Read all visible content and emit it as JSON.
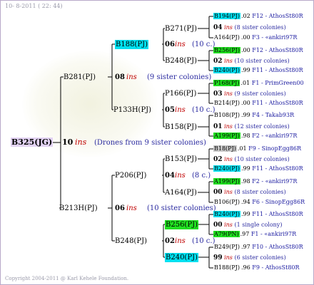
{
  "header": "10-  8-2011 ( 22: 44)",
  "footer": "Copyright 2004-2011 @ Karl Kehele Foundation.",
  "gen0": {
    "label": "B325(JG)",
    "year": "10",
    "ins": "ins",
    "note": "(Drones from 9 sister colonies)"
  },
  "gen1": {
    "sire": {
      "label": "B281(PJ)",
      "year": "08",
      "ins": "ins",
      "note": "(9 sister colonies)"
    },
    "dam": {
      "label": "B213H(PJ)",
      "year": "06",
      "ins": "ins",
      "note": "(10 sister colonies)"
    }
  },
  "gen2": [
    {
      "label": "B188(PJ)",
      "year": "06",
      "ins": "ins",
      "note": "(10 c.)"
    },
    {
      "label": "P133H(PJ)",
      "year": "05",
      "ins": "ins",
      "note": "(10 c.)"
    },
    {
      "label": "P206(PJ)",
      "year": "04",
      "ins": "ins",
      "note": "(8 c.)"
    },
    {
      "label": "B248(PJ)",
      "year": "02",
      "ins": "ins",
      "note": "(10 c.)"
    }
  ],
  "gen3": [
    "B271(PJ)",
    "B248(PJ)",
    "P166(PJ)",
    "B158(PJ)",
    "B153(PJ)",
    "A164(PJ)",
    "B256(PJ)",
    "B240(PJ)"
  ],
  "rows": [
    {
      "id": "B194(PJ)",
      "year": ".02",
      "src": "F12 - AthosSt80R"
    },
    {
      "g": "04",
      "iv": "ins",
      "nt": "(8 sister colonies)"
    },
    {
      "id": "A164(PJ)",
      "year": ".00",
      "src": "F3 - «ankiri97R"
    },
    {
      "id": "B256(PJ)",
      "year": ".00",
      "src": "F12 - AthosSt80R"
    },
    {
      "g": "02",
      "iv": "ins",
      "nt": "(10 sister colonies)"
    },
    {
      "id": "B240(PJ)",
      "year": ".99",
      "src": "F11 - AthosSt80R"
    },
    {
      "id": "P168(PJ)",
      "year": ".01",
      "src": "F1 - PrimGreen00"
    },
    {
      "g": "03",
      "iv": "ins",
      "nt": "(9 sister colonies)"
    },
    {
      "id": "B214(PJ)",
      "year": ".00",
      "src": "F11 - AthosSt80R"
    },
    {
      "id": "B108(PJ)",
      "year": ".99",
      "src": "F4 - Takab93R"
    },
    {
      "g": "01",
      "iv": "ins",
      "nt": "(12 sister colonies)"
    },
    {
      "id": "A199(PJ)",
      "year": ".98",
      "src": "F2 - «ankiri97R"
    },
    {
      "id": "B18(PJ)",
      "year": ".01",
      "src": "F9 - SinopEgg86R"
    },
    {
      "g": "02",
      "iv": "ins",
      "nt": "(10 sister colonies)"
    },
    {
      "id": "B240(PJ)",
      "year": ".99",
      "src": "F11 - AthosSt80R"
    },
    {
      "id": "A199(PJ)",
      "year": ".98",
      "src": "F2 - «ankiri97R"
    },
    {
      "g": "00",
      "iv": "ins",
      "nt": "(8 sister colonies)"
    },
    {
      "id": "B106(PJ)",
      "year": ".94",
      "src": "F6 - SinopEgg86R"
    },
    {
      "id": "B240(PJ)",
      "year": ".99",
      "src": "F11 - AthosSt80R"
    },
    {
      "g": "00",
      "iv": "ins",
      "nt": "(1 single colony)"
    },
    {
      "id": "A79(PN)",
      "year": ".97",
      "src": "F1 - «ankiri97R"
    },
    {
      "id": "B249(PJ)",
      "year": ".97",
      "src": "F10 - AthosSt80R"
    },
    {
      "g": "99",
      "iv": "ins",
      "nt": "(6 sister colonies)"
    },
    {
      "id": "B188(PJ)",
      "year": ".96",
      "src": "F9 - AthosSt80R"
    }
  ]
}
